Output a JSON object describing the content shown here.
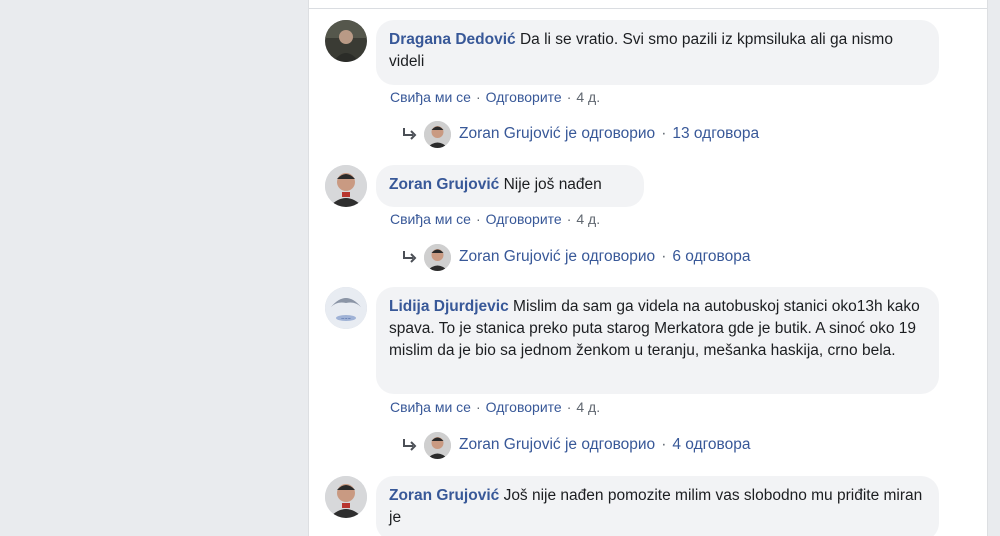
{
  "colors": {
    "link": "#385898",
    "bubble_bg": "#f2f3f5",
    "meta_text": "#606770",
    "page_bg": "#e9ebee"
  },
  "icons": {
    "reply": "reply-arrow-icon"
  },
  "comments": [
    {
      "author": "Dragana Dedović",
      "text": "Da li se vratio. Svi smo pazili iz kpmsiluka ali ga nismo videli",
      "like_label": "Свиђа ми се",
      "reply_label": "Одговорите",
      "time": "4 д.",
      "reply_summary": {
        "author": "Zoran Grujović",
        "verb": "je одговорио",
        "count_label": "13 одговора"
      }
    },
    {
      "author": "Zoran Grujović",
      "text": "Nije još nađen",
      "like_label": "Свиђа ми се",
      "reply_label": "Одговорите",
      "time": "4 д.",
      "reply_summary": {
        "author": "Zoran Grujović",
        "verb": "je одговорио",
        "count_label": "6 одговора"
      }
    },
    {
      "author": "Lidija Djurdjevic",
      "text": "Mislim da sam ga videla na autobuskoj stanici oko13h kako spava. To je stanica preko puta starog Merkatora gde je butik. A sinoć oko 19 mislim da je bio sa jednom ženkom u teranju, mešanka haskija, crno bela.",
      "like_label": "Свиђа ми се",
      "reply_label": "Одговорите",
      "time": "4 д.",
      "reply_summary": {
        "author": "Zoran Grujović",
        "verb": "je одговорио",
        "count_label": "4 одговора"
      }
    },
    {
      "author": "Zoran Grujović",
      "text": "Još nije nađen pomozite milim vas slobodno mu priđite miran je"
    }
  ]
}
